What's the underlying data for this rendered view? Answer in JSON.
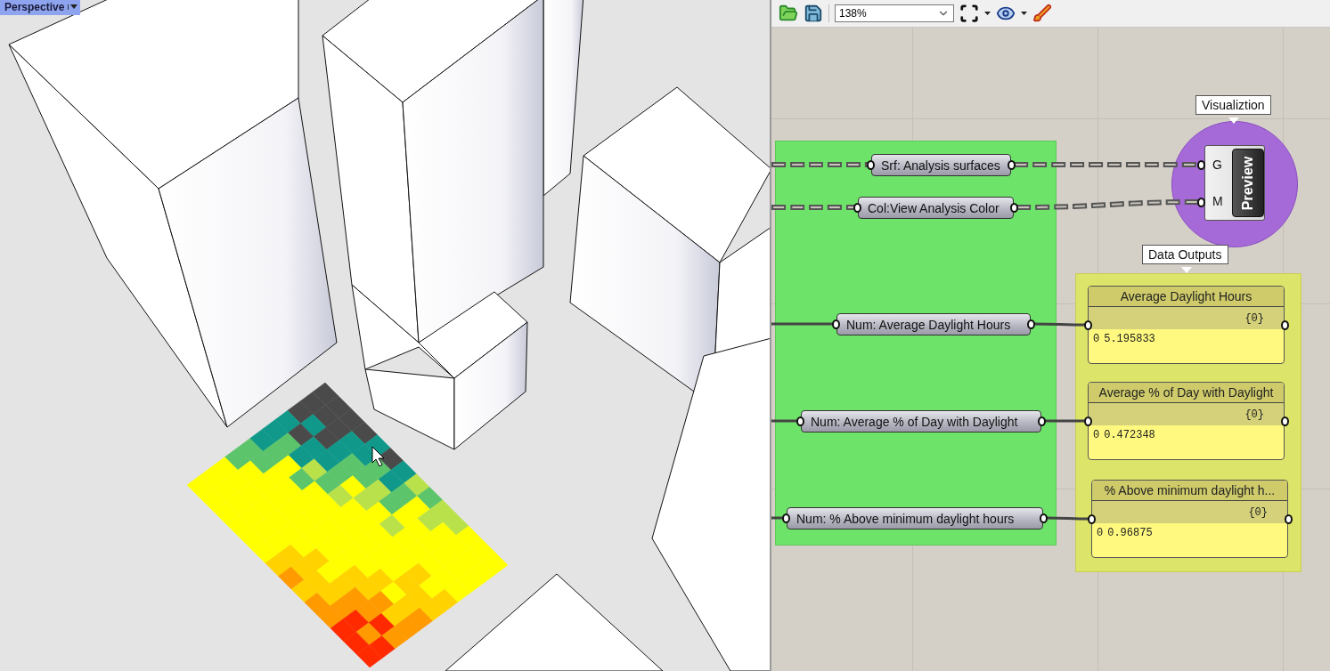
{
  "viewport": {
    "title": "Perspective"
  },
  "toolbar": {
    "zoom": "138%"
  },
  "canvas": {
    "input_params": [
      {
        "label": "Srf: Analysis surfaces",
        "kind": "list"
      },
      {
        "label": "Col:View Analysis Color",
        "kind": "list"
      },
      {
        "label": "Num: Average Daylight Hours",
        "kind": "item"
      },
      {
        "label": "Num: Average % of Day with Daylight",
        "kind": "item"
      },
      {
        "label": "Num: % Above minimum daylight hours",
        "kind": "item"
      }
    ],
    "visualization": {
      "label": "Visualiztion",
      "component": "Preview",
      "inputs": [
        "G",
        "M"
      ]
    },
    "data_outputs": {
      "label": "Data Outputs",
      "panels": [
        {
          "title": "Average Daylight Hours",
          "path": "{0}",
          "index": "0",
          "value": "5.195833"
        },
        {
          "title": "Average % of Day with Daylight",
          "path": "{0}",
          "index": "0",
          "value": "0.472348"
        },
        {
          "title": "% Above minimum daylight h...",
          "path": "{0}",
          "index": "0",
          "value": "0.96875"
        }
      ]
    }
  }
}
